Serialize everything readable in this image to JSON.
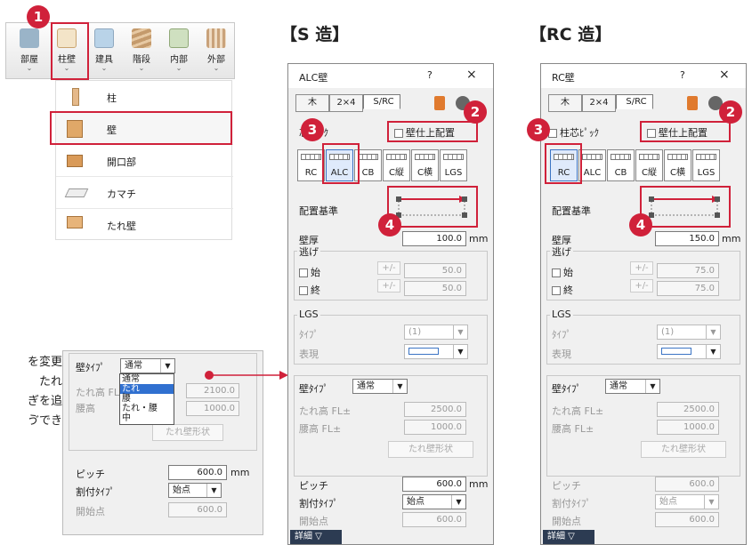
{
  "toolbar": {
    "buttons": [
      {
        "label": "部屋"
      },
      {
        "label": "柱壁"
      },
      {
        "label": "建具"
      },
      {
        "label": "階段"
      },
      {
        "label": "内部"
      },
      {
        "label": "外部"
      }
    ],
    "chev": "⌄"
  },
  "menu": {
    "items": [
      {
        "label": "柱"
      },
      {
        "label": "壁"
      },
      {
        "label": "開口部"
      },
      {
        "label": "カマチ"
      },
      {
        "label": "たれ壁"
      }
    ]
  },
  "badges": [
    "1",
    "2",
    "3",
    "4"
  ],
  "headings": {
    "s": "【S 造】",
    "rc": "【RC 造】"
  },
  "left_text": [
    "を変更",
    "たれ",
    "ぎを追",
    "ゔでき"
  ],
  "side": {
    "wall_type_label": "壁ﾀｲﾌﾟ",
    "wall_type": "通常",
    "options": [
      "通常",
      "たれ",
      "腰",
      "たれ・腰",
      "中"
    ],
    "tare_label": "たれ高 FL",
    "koshi_label": "腰高",
    "tare_val": "2100.0",
    "koshi_val": "1000.0",
    "tare_btn": "たれ壁形状",
    "pitch_label": "ピッチ",
    "pitch_val": "600.0",
    "pitch_unit": "mm",
    "alloc_label": "割付ﾀｲﾌﾟ",
    "alloc_val": "始点",
    "start_label": "開始点",
    "start_val": "600.0"
  },
  "dlg_s": {
    "title": "ALC壁",
    "help": "?",
    "close": "×",
    "tabs": [
      "木",
      "2×4",
      "S/RC"
    ],
    "core_pick": "芯ﾋﾟｯｸ",
    "finish": "壁仕上配置",
    "mtypes": [
      "RC",
      "ALC",
      "CB",
      "C縦",
      "C横",
      "LGS"
    ],
    "ref_label": "配置基準",
    "thick_label": "壁厚",
    "thick_val": "100.0",
    "unit": "mm",
    "nige": "逃げ",
    "start": "始",
    "end": "終",
    "pm": "+/-",
    "nige_s": "50.0",
    "nige_e": "50.0",
    "lgs": "LGS",
    "type_lbl": "ﾀｲﾌﾟ",
    "type_val": "(1)",
    "disp_lbl": "表現",
    "wt_label": "壁ﾀｲﾌﾟ",
    "wt_val": "通常",
    "tare_lbl": "たれ高 FL±",
    "koshi_lbl": "腰高   FL±",
    "tare_v": "2500.0",
    "koshi_v": "1000.0",
    "tare_btn": "たれ壁形状",
    "pitch_lbl": "ピッチ",
    "pitch_v": "600.0",
    "alloc_lbl": "割付ﾀｲﾌﾟ",
    "alloc_v": "始点",
    "start_lbl": "開始点",
    "start_v": "600.0",
    "detail": "詳細"
  },
  "dlg_rc": {
    "title": "RC壁",
    "help": "?",
    "close": "×",
    "tabs": [
      "木",
      "2×4",
      "S/RC"
    ],
    "core_pick": "柱芯ﾋﾟｯｸ",
    "finish": "壁仕上配置",
    "mtypes": [
      "RC",
      "ALC",
      "CB",
      "C縦",
      "C横",
      "LGS"
    ],
    "ref_label": "配置基準",
    "thick_label": "壁厚",
    "thick_val": "150.0",
    "unit": "mm",
    "nige": "逃げ",
    "start": "始",
    "end": "終",
    "pm": "+/-",
    "nige_s": "75.0",
    "nige_e": "75.0",
    "lgs": "LGS",
    "type_lbl": "ﾀｲﾌﾟ",
    "type_val": "(1)",
    "disp_lbl": "表現",
    "wt_label": "壁ﾀｲﾌﾟ",
    "wt_val": "通常",
    "tare_lbl": "たれ高 FL±",
    "koshi_lbl": "腰高   FL±",
    "tare_v": "2500.0",
    "koshi_v": "1000.0",
    "tare_btn": "たれ壁形状",
    "pitch_lbl": "ピッチ",
    "pitch_v": "600.0",
    "alloc_lbl": "割付ﾀｲﾌﾟ",
    "alloc_v": "始点",
    "start_lbl": "開始点",
    "start_v": "600.0",
    "detail": "詳細"
  },
  "colors": {
    "accent": "#d0213a"
  }
}
